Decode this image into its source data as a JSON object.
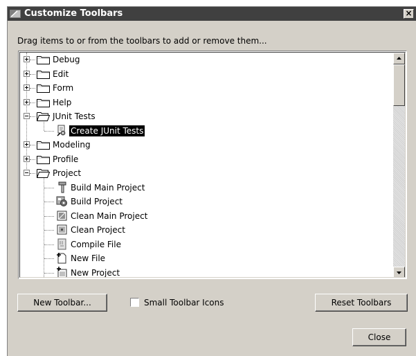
{
  "window": {
    "title": "Customize Toolbars",
    "close_glyph": "×"
  },
  "instruction": "Drag items to or from the toolbars to add or remove them...",
  "tree": {
    "items": [
      {
        "label": "Debug",
        "icon": "folder-icon",
        "expander": "plus",
        "level": 0
      },
      {
        "label": "Edit",
        "icon": "folder-icon",
        "expander": "plus",
        "level": 0
      },
      {
        "label": "Form",
        "icon": "folder-icon",
        "expander": "plus",
        "level": 0
      },
      {
        "label": "Help",
        "icon": "folder-icon",
        "expander": "plus",
        "level": 0
      },
      {
        "label": "JUnit Tests",
        "icon": "folder-open-icon",
        "expander": "minus",
        "level": 0
      },
      {
        "label": "Create JUnit Tests",
        "icon": "junit-test-icon",
        "level": 1,
        "selected": true
      },
      {
        "label": "Modeling",
        "icon": "folder-icon",
        "expander": "plus",
        "level": 0
      },
      {
        "label": "Profile",
        "icon": "folder-icon",
        "expander": "plus",
        "level": 0
      },
      {
        "label": "Project",
        "icon": "folder-open-icon",
        "expander": "minus",
        "level": 0
      },
      {
        "label": "Build Main Project",
        "icon": "hammer-icon",
        "level": 1
      },
      {
        "label": "Build Project",
        "icon": "build-project-icon",
        "level": 1
      },
      {
        "label": "Clean Main Project",
        "icon": "clean-main-project-icon",
        "level": 1
      },
      {
        "label": "Clean Project",
        "icon": "clean-project-icon",
        "level": 1
      },
      {
        "label": "Compile File",
        "icon": "compile-file-icon",
        "level": 1
      },
      {
        "label": "New File",
        "icon": "new-file-icon",
        "level": 1
      },
      {
        "label": "New Project",
        "icon": "new-project-icon",
        "level": 1
      }
    ]
  },
  "buttons": {
    "new_toolbar": "New Toolbar...",
    "reset_toolbars": "Reset Toolbars",
    "close": "Close"
  },
  "checkbox": {
    "label": "Small Toolbar Icons",
    "checked": false
  },
  "colors": {
    "titlebar": "#404040",
    "dialog_bg": "#d4d0c8",
    "selection": "#000000"
  }
}
